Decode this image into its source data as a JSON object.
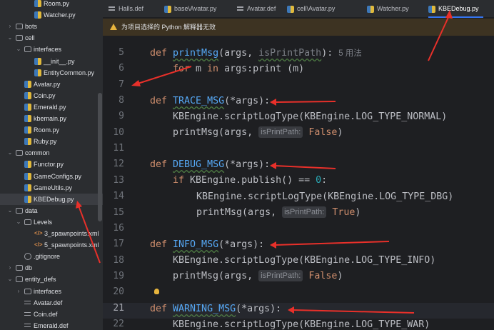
{
  "project_tree": {
    "items": [
      {
        "label": "Room.py",
        "icon": "python-file-icon",
        "kind": "py"
      },
      {
        "label": "Watcher.py",
        "icon": "python-file-icon",
        "kind": "py"
      },
      {
        "label": "bots",
        "icon": "folder-icon",
        "kind": "folder",
        "expanded": false
      },
      {
        "label": "cell",
        "icon": "folder-icon",
        "kind": "folder",
        "expanded": true
      },
      {
        "label": "interfaces",
        "icon": "folder-icon",
        "kind": "folder",
        "expanded": true
      },
      {
        "label": "__init__.py",
        "icon": "python-file-icon",
        "kind": "py"
      },
      {
        "label": "EntityCommon.py",
        "icon": "python-file-icon",
        "kind": "py"
      },
      {
        "label": "Avatar.py",
        "icon": "python-file-icon",
        "kind": "py"
      },
      {
        "label": "Coin.py",
        "icon": "python-file-icon",
        "kind": "py"
      },
      {
        "label": "Emerald.py",
        "icon": "python-file-icon",
        "kind": "py"
      },
      {
        "label": "kbemain.py",
        "icon": "python-file-icon",
        "kind": "py"
      },
      {
        "label": "Room.py",
        "icon": "python-file-icon",
        "kind": "py"
      },
      {
        "label": "Ruby.py",
        "icon": "python-file-icon",
        "kind": "py"
      },
      {
        "label": "common",
        "icon": "folder-icon",
        "kind": "folder",
        "expanded": true
      },
      {
        "label": "Functor.py",
        "icon": "python-file-icon",
        "kind": "py"
      },
      {
        "label": "GameConfigs.py",
        "icon": "python-file-icon",
        "kind": "py"
      },
      {
        "label": "GameUtils.py",
        "icon": "python-file-icon",
        "kind": "py"
      },
      {
        "label": "KBEDebug.py",
        "icon": "python-file-icon",
        "kind": "py",
        "selected": true
      },
      {
        "label": "data",
        "icon": "folder-icon",
        "kind": "folder",
        "expanded": true
      },
      {
        "label": "Levels",
        "icon": "folder-icon",
        "kind": "folder",
        "expanded": true
      },
      {
        "label": "3_spawnpoints.xml",
        "icon": "xml-file-icon",
        "kind": "xml"
      },
      {
        "label": "5_spawnpoints.xml",
        "icon": "xml-file-icon",
        "kind": "xml"
      },
      {
        "label": ".gitignore",
        "icon": "gitignore-icon",
        "kind": "git"
      },
      {
        "label": "db",
        "icon": "folder-icon",
        "kind": "folder",
        "expanded": false
      },
      {
        "label": "entity_defs",
        "icon": "folder-icon",
        "kind": "folder",
        "expanded": true
      },
      {
        "label": "interfaces",
        "icon": "folder-icon",
        "kind": "folder",
        "expanded": false
      },
      {
        "label": "Avatar.def",
        "icon": "def-file-icon",
        "kind": "def"
      },
      {
        "label": "Coin.def",
        "icon": "def-file-icon",
        "kind": "def"
      },
      {
        "label": "Emerald.def",
        "icon": "def-file-icon",
        "kind": "def"
      }
    ]
  },
  "tabs": [
    {
      "label": "Halls.def",
      "icon": "def-file-icon",
      "kind": "def"
    },
    {
      "label": "base\\Avatar.py",
      "icon": "python-file-icon",
      "kind": "py"
    },
    {
      "label": "Avatar.def",
      "icon": "def-file-icon",
      "kind": "def"
    },
    {
      "label": "cell\\Avatar.py",
      "icon": "python-file-icon",
      "kind": "py"
    },
    {
      "label": "Watcher.py",
      "icon": "python-file-icon",
      "kind": "py"
    },
    {
      "label": "KBEDebug.py",
      "icon": "python-file-icon",
      "kind": "py",
      "active": true
    }
  ],
  "banner": {
    "icon": "warning-icon",
    "text": "为项目选择的 Python 解释器无效"
  },
  "editor": {
    "line_numbers": [
      "5",
      "6",
      "7",
      "8",
      "9",
      "10",
      "11",
      "12",
      "13",
      "14",
      "15",
      "16",
      "17",
      "18",
      "19",
      "20",
      "21",
      "22"
    ],
    "current_line": "21",
    "code": {
      "l5_def": "def ",
      "l5_name": "printMsg",
      "l5_args": "(args, ",
      "l5_param": "isPrintPath",
      "l5_end": "):",
      "l5_usages": "5 用法",
      "l6_for": "for ",
      "l6_m": "m ",
      "l6_in": "in ",
      "l6_rest": "args:print (m)",
      "l8_def": "def ",
      "l8_name": "TRACE_MSG",
      "l8_args": "(*args):",
      "l9": "KBEngine.scriptLogType(KBEngine.LOG_TYPE_NORMAL)",
      "l10_a": "printMsg(args, ",
      "l10_hint": "isPrintPath:",
      "l10_val": "False",
      "l10_b": ")",
      "l12_def": "def ",
      "l12_name": "DEBUG_MSG",
      "l12_args": "(*args):",
      "l13_if": "if ",
      "l13_a": "KBEngine.publish() == ",
      "l13_num": "0",
      "l13_b": ":",
      "l14": "KBEngine.scriptLogType(KBEngine.LOG_TYPE_DBG)",
      "l15_a": "printMsg(args, ",
      "l15_hint": "isPrintPath:",
      "l15_val": "True",
      "l15_b": ")",
      "l17_def": "def ",
      "l17_name": "INFO_MSG",
      "l17_args": "(*args):",
      "l18": "KBEngine.scriptLogType(KBEngine.LOG_TYPE_INFO)",
      "l19_a": "printMsg(args, ",
      "l19_hint": "isPrintPath:",
      "l19_val": "False",
      "l19_b": ")",
      "l21_def": "def ",
      "l21_name": "WARNING_MSG",
      "l21_args": "(*args):",
      "l22": "KBEngine.scriptLogType(KBEngine.LOG_TYPE_WAR)"
    }
  },
  "colors": {
    "keyword": "#cf8e6d",
    "function": "#56a8f5",
    "number": "#2aacb8",
    "annotation_arrow": "#e8302a",
    "active_tab_underline": "#3574f0"
  }
}
